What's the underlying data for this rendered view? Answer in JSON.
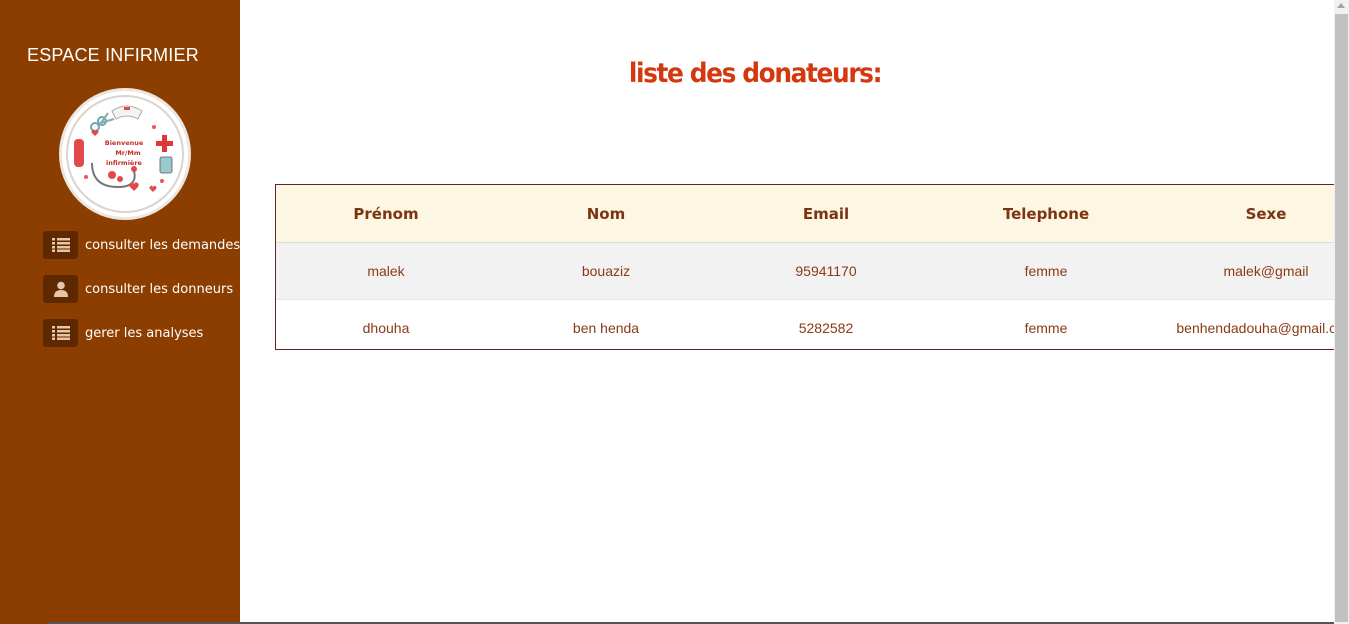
{
  "sidebar": {
    "title": "ESPACE INFIRMIER",
    "logo_text": [
      "Bienvenue",
      "Mr/Mm",
      "infirmière"
    ],
    "items": [
      {
        "label": "consulter les demandes",
        "icon": "list-icon"
      },
      {
        "label": "consulter les donneurs",
        "icon": "user-icon"
      },
      {
        "label": "gerer les analyses",
        "icon": "list-icon"
      }
    ]
  },
  "main": {
    "title": "liste des donateurs:"
  },
  "table": {
    "headers": [
      "Prénom",
      "Nom",
      "Email",
      "Telephone",
      "Sexe"
    ],
    "rows": [
      [
        "malek",
        "bouaziz",
        "95941170",
        "femme",
        "malek@gmail"
      ],
      [
        "dhouha",
        "ben henda",
        "5282582",
        "femme",
        "benhendadouha@gmail.com"
      ]
    ]
  },
  "colors": {
    "sidebar_bg": "#8b3e00",
    "title_color": "#d3380f",
    "header_bg": "#fdf6e3"
  }
}
